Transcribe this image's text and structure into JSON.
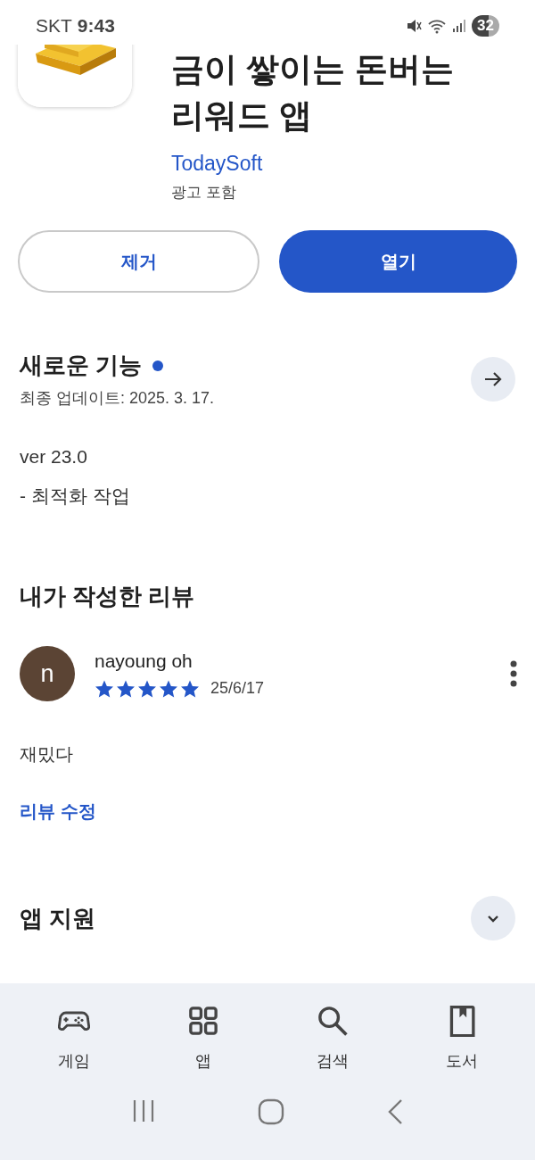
{
  "status_bar": {
    "carrier": "SKT",
    "time": "9:43",
    "battery": "32"
  },
  "app": {
    "title": "금이 쌓이는 돈버는 리워드 앱",
    "developer": "TodaySoft",
    "ads_note": "광고 포함"
  },
  "buttons": [
    {
      "label": "제거",
      "kind": "outline"
    },
    {
      "label": "열기",
      "kind": "filled"
    }
  ],
  "whats_new": {
    "title": "새로운 기능",
    "new_dot": true,
    "updated": "최종 업데이트: 2025. 3. 17.",
    "notes": [
      "ver 23.0",
      "- 최적화 작업"
    ]
  },
  "my_review": {
    "title": "내가 작성한 리뷰",
    "avatar_letter": "n",
    "author": "nayoung oh",
    "stars": 5,
    "date": "25/6/17",
    "text": "재밌다",
    "edit_link": "리뷰 수정"
  },
  "app_support": {
    "title": "앱 지원",
    "expanded": false
  },
  "bottom_nav": [
    {
      "label": "게임",
      "kind": "gamepad",
      "selected": false
    },
    {
      "label": "앱",
      "kind": "apps",
      "selected": false
    },
    {
      "label": "검색",
      "kind": "search",
      "selected": false
    },
    {
      "label": "도서",
      "kind": "book",
      "selected": false
    }
  ]
}
